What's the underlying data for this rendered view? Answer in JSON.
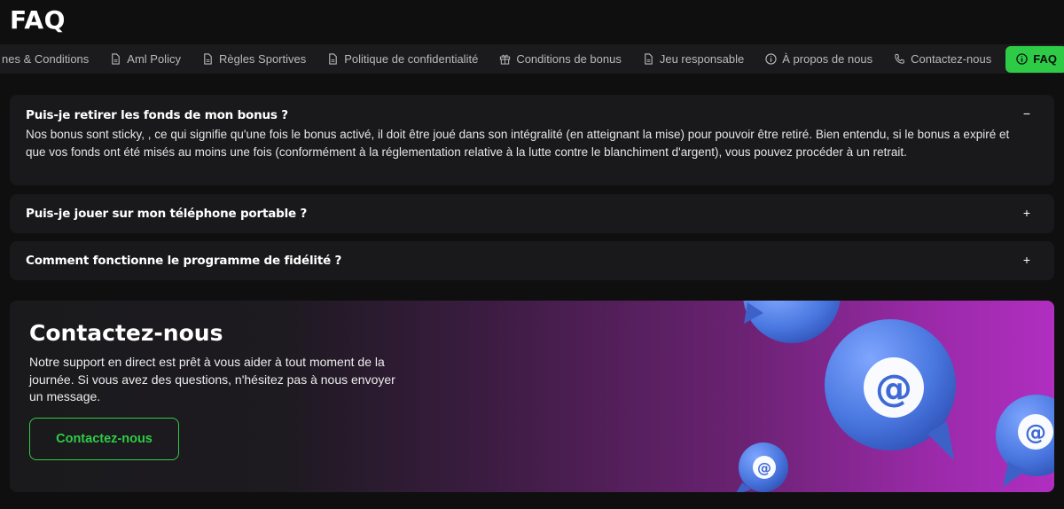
{
  "page": {
    "title": "FAQ"
  },
  "tabs": [
    {
      "label": "nes & Conditions",
      "icon": "none"
    },
    {
      "label": "Aml Policy",
      "icon": "document-icon"
    },
    {
      "label": "Règles Sportives",
      "icon": "document-icon"
    },
    {
      "label": "Politique de confidentialité",
      "icon": "document-icon"
    },
    {
      "label": "Conditions de bonus",
      "icon": "gift-icon"
    },
    {
      "label": "Jeu responsable",
      "icon": "document-icon"
    },
    {
      "label": "À propos de nous",
      "icon": "info-icon"
    },
    {
      "label": "Contactez-nous",
      "icon": "phone-icon"
    },
    {
      "label": "FAQ",
      "icon": "info-icon",
      "active": true
    }
  ],
  "faq": [
    {
      "question": "Puis-je retirer les fonds de mon bonus ?",
      "toggle": "−",
      "answer": "Nos bonus sont sticky, , ce qui signifie qu'une fois le bonus activé, il doit être joué dans son intégralité (en atteignant la mise) pour pouvoir être retiré. Bien entendu, si le bonus a expiré et que vos fonds ont été misés au moins une fois (conformément à la réglementation relative à la lutte contre le blanchiment d'argent), vous pouvez procéder à un retrait."
    },
    {
      "question": "Puis-je jouer sur mon téléphone portable ?",
      "toggle": "+"
    },
    {
      "question": "Comment fonctionne le programme de fidélité ?",
      "toggle": "+"
    }
  ],
  "contact": {
    "title": "Contactez-nous",
    "text": "Notre support en direct est prêt à vous aider à tout moment de la journée. Si vous avez des questions, n'hésitez pas à nous envoyer un message.",
    "button_label": "Contactez-nous",
    "at_symbol": "@"
  },
  "colors": {
    "accent": "#2ecc46",
    "background": "#0f0f10",
    "card": "#19191b",
    "bubble": "#4a78e0"
  }
}
